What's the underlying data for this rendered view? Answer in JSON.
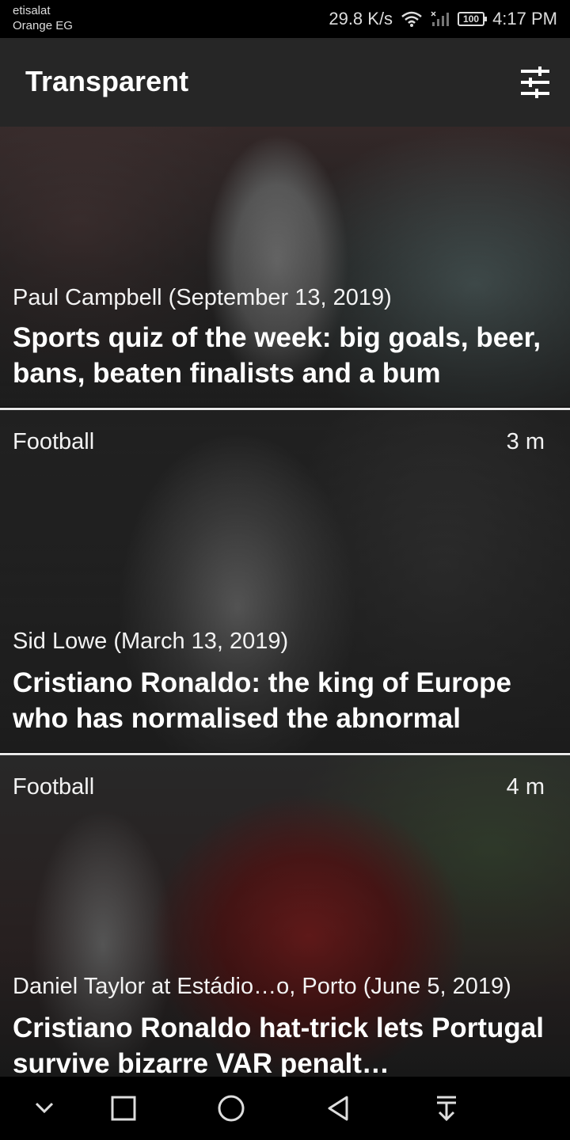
{
  "status_bar": {
    "carrier_line1": "etisalat",
    "carrier_line2": "Orange EG",
    "speed": "29.8 K/s",
    "battery": "100",
    "time": "4:17 PM"
  },
  "app_bar": {
    "title": "Transparent",
    "filter_icon": "tune-icon"
  },
  "articles": [
    {
      "category": "",
      "age": "",
      "byline": "Paul Campbell (September 13, 2019)",
      "headline": "Sports quiz of the week: big goals, beer, bans, beaten finalists and a bum"
    },
    {
      "category": "Football",
      "age": "3 m",
      "byline": "Sid Lowe (March 13, 2019)",
      "headline": "Cristiano Ronaldo: the king of Europe who has normalised the abnormal"
    },
    {
      "category": "Football",
      "age": "4 m",
      "byline": "Daniel Taylor at Estádio…o, Porto (June 5, 2019)",
      "headline": "Cristiano Ronaldo hat-trick lets Portugal survive bizarre VAR penalt…"
    }
  ],
  "nav_bar": {
    "icons": [
      "chevron-down-icon",
      "square-recents-icon",
      "circle-home-icon",
      "triangle-back-icon",
      "pull-down-icon"
    ]
  },
  "colors": {
    "app_bar": "#262626",
    "background": "#000000",
    "text": "#ffffff"
  }
}
